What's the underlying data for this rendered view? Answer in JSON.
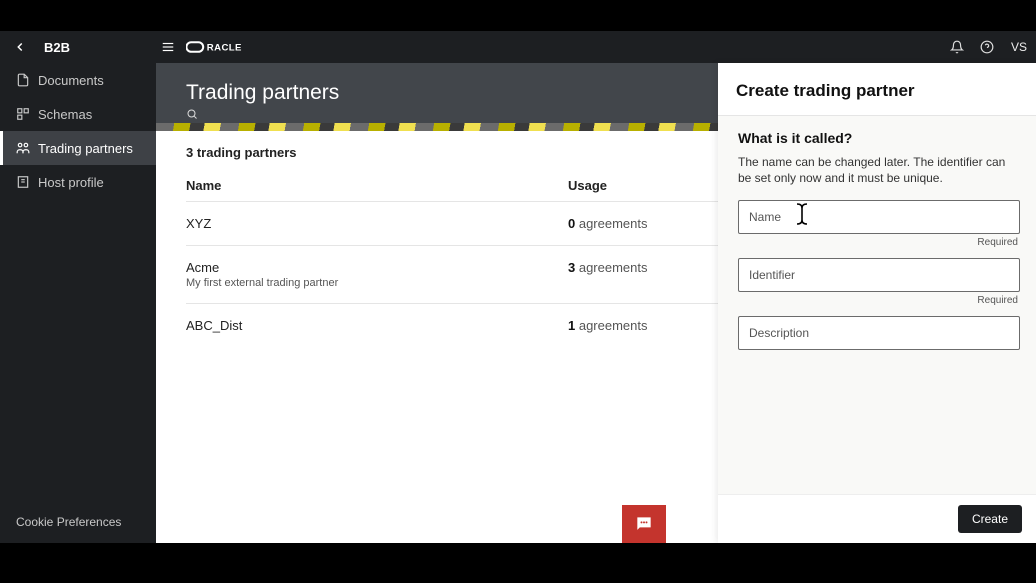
{
  "top": {
    "b2b": "B2B",
    "user_initials": "VS"
  },
  "sidebar": {
    "items": [
      {
        "label": "Documents"
      },
      {
        "label": "Schemas"
      },
      {
        "label": "Trading partners"
      },
      {
        "label": "Host profile"
      }
    ],
    "footer": "Cookie Preferences"
  },
  "page": {
    "title": "Trading partners",
    "count_line": "3 trading partners",
    "columns": {
      "name": "Name",
      "usage": "Usage"
    },
    "rows": [
      {
        "name": "XYZ",
        "sub": "",
        "usage_num": "0",
        "usage_txt": " agreements"
      },
      {
        "name": "Acme",
        "sub": "My first external trading partner",
        "usage_num": "3",
        "usage_txt": " agreements"
      },
      {
        "name": "ABC_Dist",
        "sub": "",
        "usage_num": "1",
        "usage_txt": " agreements"
      }
    ]
  },
  "panel": {
    "title": "Create trading partner",
    "question": "What is it called?",
    "hint": "The name can be changed later. The identifier can be set only now and it must be unique.",
    "name_label": "Name",
    "identifier_label": "Identifier",
    "description_label": "Description",
    "required": "Required",
    "create": "Create"
  }
}
